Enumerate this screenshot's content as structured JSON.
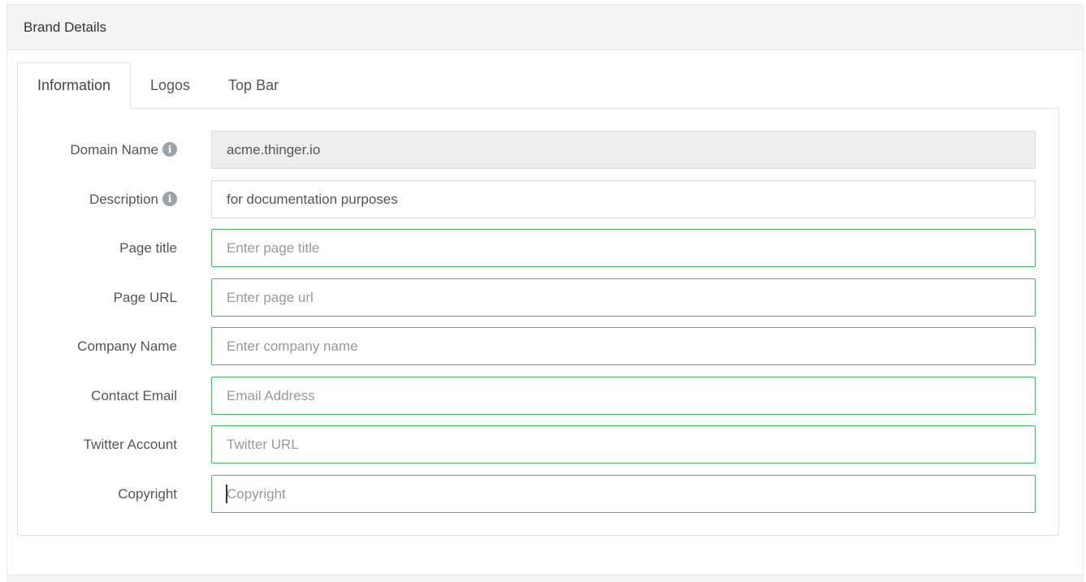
{
  "panel": {
    "title": "Brand Details"
  },
  "tabs": [
    {
      "label": "Information",
      "active": true
    },
    {
      "label": "Logos",
      "active": false
    },
    {
      "label": "Top Bar",
      "active": false
    }
  ],
  "form": {
    "fields": [
      {
        "label": "Domain Name",
        "value": "acme.thinger.io",
        "placeholder": "",
        "state": "disabled",
        "has_info": true
      },
      {
        "label": "Description",
        "value": "for documentation purposes",
        "placeholder": "",
        "state": "normal",
        "has_info": true
      },
      {
        "label": "Page title",
        "value": "",
        "placeholder": "Enter page title",
        "state": "valid"
      },
      {
        "label": "Page URL",
        "value": "",
        "placeholder": "Enter page url",
        "state": "valid"
      },
      {
        "label": "Company Name",
        "value": "",
        "placeholder": "Enter company name",
        "state": "valid"
      },
      {
        "label": "Contact Email",
        "value": "",
        "placeholder": "Email Address",
        "state": "valid"
      },
      {
        "label": "Twitter Account",
        "value": "",
        "placeholder": "Twitter URL",
        "state": "valid"
      },
      {
        "label": "Copyright",
        "value": "",
        "placeholder": "Copyright",
        "state": "valid-focused"
      }
    ]
  },
  "icons": {
    "info": "info-circle-icon"
  },
  "colors": {
    "valid_border": "#4cb466",
    "disabled_bg": "#eeeeee",
    "header_bg": "#f3f4f4"
  }
}
